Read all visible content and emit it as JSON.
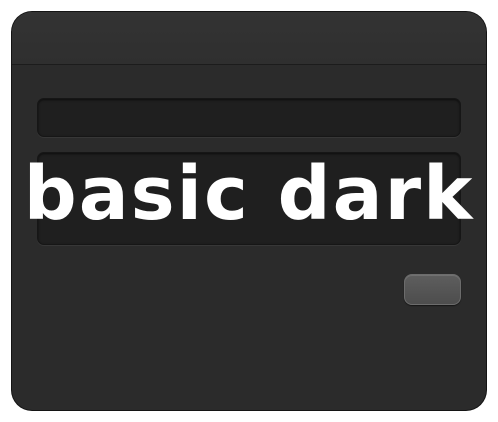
{
  "theme": {
    "name_text": "basic dark",
    "colors": {
      "window": "#2b2b2b",
      "field": "#1f1f1f",
      "button": "#555555",
      "text": "#ffffff"
    }
  },
  "window": {
    "title": ""
  },
  "fields": {
    "top_value": "",
    "main_value": ""
  },
  "buttons": {
    "action_label": ""
  }
}
